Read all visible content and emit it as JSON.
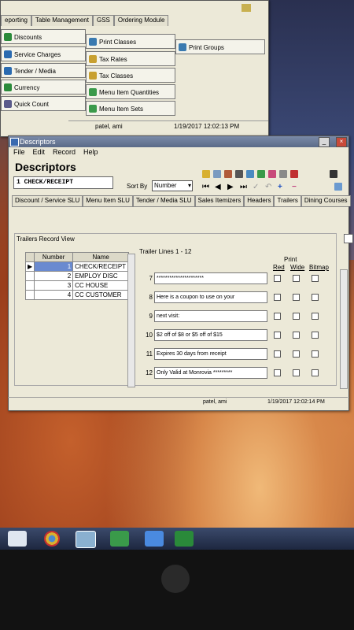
{
  "back_window": {
    "tabs": [
      "eporting",
      "Table Management",
      "GSS",
      "Ordering Module"
    ],
    "grid": [
      {
        "label": "Discounts",
        "icon": "discount-icon"
      },
      {
        "label": "Print Classes",
        "icon": "printer-icon"
      },
      {
        "label": "Print Groups",
        "icon": "printer-icon"
      },
      {
        "label": "Service Charges",
        "icon": "service-icon"
      },
      {
        "label": "Tax Rates",
        "icon": "tax-icon"
      },
      {
        "label": "Tender / Media",
        "icon": "tender-icon"
      },
      {
        "label": "Tax Classes",
        "icon": "tax-icon"
      },
      {
        "label": "Currency",
        "icon": "currency-icon"
      },
      {
        "label": "Menu Item Quantities",
        "icon": "menu-icon"
      },
      {
        "label": "Quick Count",
        "icon": "count-icon"
      },
      {
        "label": "Menu Item Sets",
        "icon": "menu-icon"
      }
    ],
    "status": {
      "user": "patel, ami",
      "datetime": "1/19/2017 12:02:13 PM"
    }
  },
  "main_window": {
    "title": "Descriptors",
    "menu": [
      "File",
      "Edit",
      "Record",
      "Help"
    ],
    "header_title": "Descriptors",
    "record": "1 CHECK/RECEIPT",
    "sort_label": "Sort By",
    "sort_value": "Number",
    "tabs": [
      "Discount / Service SLU",
      "Menu Item SLU",
      "Tender / Media SLU",
      "Sales Itemizers",
      "Headers",
      "Trailers",
      "Dining Courses"
    ],
    "active_tab": "Trailers",
    "group_title": "Trailers Record View",
    "table_headers": [
      "Number",
      "Name"
    ],
    "records": [
      {
        "number": "1",
        "name": "CHECK/RECEIPT"
      },
      {
        "number": "2",
        "name": "EMPLOY DISC"
      },
      {
        "number": "3",
        "name": "CC HOUSE"
      },
      {
        "number": "4",
        "name": "CC CUSTOMER"
      }
    ],
    "trailer_lines_title": "Trailer Lines 1 - 12",
    "print_header": "Print",
    "print_cols": [
      "Red",
      "Wide",
      "Bitmap"
    ],
    "trailer_lines": [
      {
        "n": "7",
        "text": "**********************"
      },
      {
        "n": "8",
        "text": "Here is a coupon to use on your"
      },
      {
        "n": "9",
        "text": "next visit:"
      },
      {
        "n": "10",
        "text": "$2 off of $8 or $5 off of $15"
      },
      {
        "n": "11",
        "text": "Expires 30 days from receipt"
      },
      {
        "n": "12",
        "text": "Only Valid at Monrovia *********"
      }
    ],
    "status": {
      "user": "patel, ami",
      "datetime": "1/19/2017 12:02:14 PM"
    }
  },
  "taskbar": {
    "items": [
      "start-button",
      "chrome-icon",
      "app-icon",
      "photos-icon",
      "dropbox-icon",
      "excel-icon"
    ]
  },
  "colors": {
    "titlebar": "#5b6b88",
    "window": "#ece9d8",
    "selection": "#6a8ad0"
  }
}
